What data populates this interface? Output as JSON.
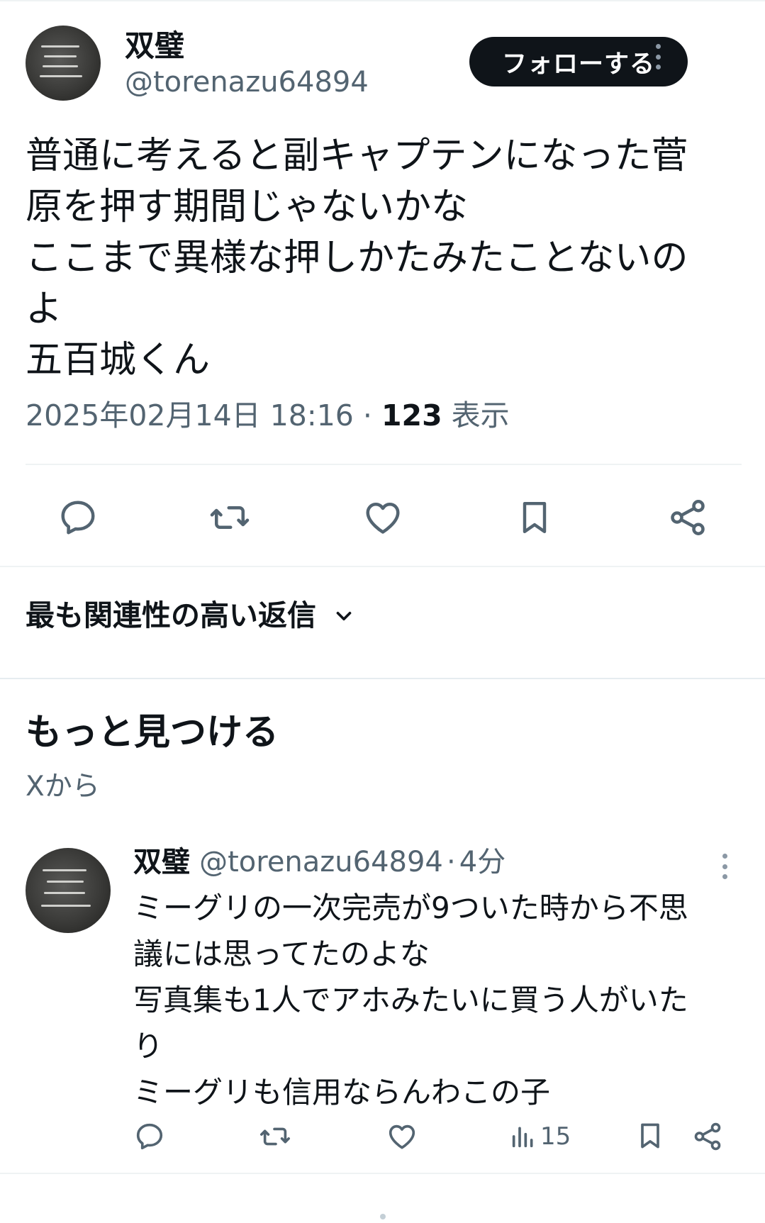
{
  "post": {
    "author_name": "双璧",
    "author_handle": "@torenazu64894",
    "follow_label": "フォローする",
    "text": "普通に考えると副キャプテンになった菅\n原を押す期間じゃないかな\nここまで異様な押しかたみたことないの\nよ\n五百城くん",
    "timestamp": "2025年02月14日 18:16",
    "separator": "·",
    "views_count": "123",
    "views_label": "表示",
    "actions": [
      "reply-icon",
      "repost-icon",
      "like-icon",
      "bookmark-icon",
      "share-icon"
    ]
  },
  "replies_sort": {
    "label": "最も関連性の高い返信",
    "icon": "chevron-down-icon"
  },
  "discover": {
    "title": "もっと見つける",
    "subtitle": "Xから"
  },
  "related_post": {
    "author_name": "双璧",
    "author_handle": "@torenazu64894",
    "separator": "·",
    "time_ago": "4分",
    "text": "ミーグリの一次完売が9ついた時から不思\n議には思ってたのよな\n写真集も1人でアホみたいに買う人がいた\nり\nミーグリも信用ならんわこの子",
    "views_count": "15",
    "actions": [
      "reply-icon",
      "repost-icon",
      "like-icon",
      "views-icon",
      "bookmark-icon",
      "share-icon"
    ]
  },
  "colors": {
    "text_primary": "#0f1419",
    "text_secondary": "#536471",
    "divider": "#eff3f4",
    "button_bg": "#0f1419",
    "button_text": "#ffffff"
  }
}
